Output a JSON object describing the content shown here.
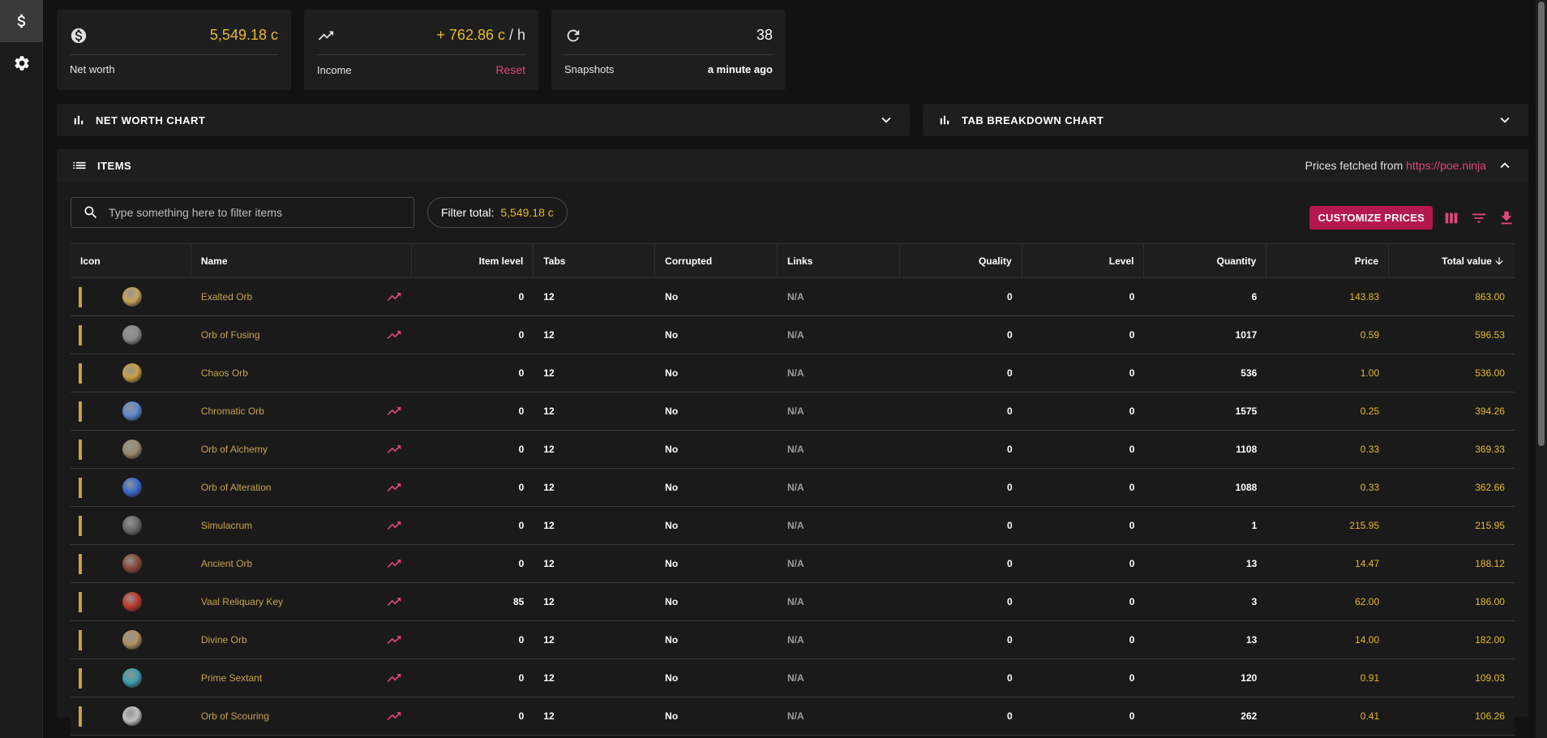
{
  "colors": {
    "accent": "#e0457c",
    "gold": "#e8b92a",
    "button": "#b5174f"
  },
  "sidebar": {
    "items": [
      {
        "icon": "dollar-icon",
        "active": true
      },
      {
        "icon": "gear-icon",
        "active": false
      }
    ]
  },
  "cards": {
    "networth": {
      "value": "5,549.18 c",
      "label": "Net worth"
    },
    "income": {
      "value": "+ 762.86 c",
      "unit": " / h",
      "label": "Income",
      "reset": "Reset"
    },
    "snapshots": {
      "value": "38",
      "label": "Snapshots",
      "ago": "a minute ago"
    }
  },
  "charts": {
    "networth_title": "NET WORTH CHART",
    "tab_title": "TAB BREAKDOWN CHART"
  },
  "items": {
    "title": "ITEMS",
    "prices_from": "Prices fetched from",
    "prices_link": "https://poe.ninja",
    "search_placeholder": "Type something here to filter items",
    "filter_total_label": "Filter total:",
    "filter_total_value": "5,549.18 c",
    "customize": "CUSTOMIZE PRICES",
    "columns": {
      "icon": "Icon",
      "name": "Name",
      "ilvl": "Item level",
      "tabs": "Tabs",
      "corrupted": "Corrupted",
      "links": "Links",
      "quality": "Quality",
      "level": "Level",
      "quantity": "Quantity",
      "price": "Price",
      "total": "Total value"
    },
    "rows": [
      {
        "name": "Exalted Orb",
        "ilvl": "0",
        "tabs": "12",
        "corrupted": "No",
        "links": "N/A",
        "quality": "0",
        "level": "0",
        "quantity": "6",
        "price": "143.83",
        "total": "863.00",
        "trend": true,
        "color": "#c8a35a"
      },
      {
        "name": "Orb of Fusing",
        "ilvl": "0",
        "tabs": "12",
        "corrupted": "No",
        "links": "N/A",
        "quality": "0",
        "level": "0",
        "quantity": "1017",
        "price": "0.59",
        "total": "596.53",
        "trend": true,
        "color": "#8a8a8a"
      },
      {
        "name": "Chaos Orb",
        "ilvl": "0",
        "tabs": "12",
        "corrupted": "No",
        "links": "N/A",
        "quality": "0",
        "level": "0",
        "quantity": "536",
        "price": "1.00",
        "total": "536.00",
        "trend": false,
        "color": "#c9a040"
      },
      {
        "name": "Chromatic Orb",
        "ilvl": "0",
        "tabs": "12",
        "corrupted": "No",
        "links": "N/A",
        "quality": "0",
        "level": "0",
        "quantity": "1575",
        "price": "0.25",
        "total": "394.26",
        "trend": true,
        "color": "#5a8ad0"
      },
      {
        "name": "Orb of Alchemy",
        "ilvl": "0",
        "tabs": "12",
        "corrupted": "No",
        "links": "N/A",
        "quality": "0",
        "level": "0",
        "quantity": "1108",
        "price": "0.33",
        "total": "369.33",
        "trend": true,
        "color": "#9a8a6a"
      },
      {
        "name": "Orb of Alteration",
        "ilvl": "0",
        "tabs": "12",
        "corrupted": "No",
        "links": "N/A",
        "quality": "0",
        "level": "0",
        "quantity": "1088",
        "price": "0.33",
        "total": "362.66",
        "trend": true,
        "color": "#3a6ad0"
      },
      {
        "name": "Simulacrum",
        "ilvl": "0",
        "tabs": "12",
        "corrupted": "No",
        "links": "N/A",
        "quality": "0",
        "level": "0",
        "quantity": "1",
        "price": "215.95",
        "total": "215.95",
        "trend": true,
        "color": "#6a6a6a"
      },
      {
        "name": "Ancient Orb",
        "ilvl": "0",
        "tabs": "12",
        "corrupted": "No",
        "links": "N/A",
        "quality": "0",
        "level": "0",
        "quantity": "13",
        "price": "14.47",
        "total": "188.12",
        "trend": true,
        "color": "#8a4a3a"
      },
      {
        "name": "Vaal Reliquary Key",
        "ilvl": "85",
        "tabs": "12",
        "corrupted": "No",
        "links": "N/A",
        "quality": "0",
        "level": "0",
        "quantity": "3",
        "price": "62.00",
        "total": "186.00",
        "trend": true,
        "color": "#c03a2a"
      },
      {
        "name": "Divine Orb",
        "ilvl": "0",
        "tabs": "12",
        "corrupted": "No",
        "links": "N/A",
        "quality": "0",
        "level": "0",
        "quantity": "13",
        "price": "14.00",
        "total": "182.00",
        "trend": true,
        "color": "#b09060"
      },
      {
        "name": "Prime Sextant",
        "ilvl": "0",
        "tabs": "12",
        "corrupted": "No",
        "links": "N/A",
        "quality": "0",
        "level": "0",
        "quantity": "120",
        "price": "0.91",
        "total": "109.03",
        "trend": true,
        "color": "#3aa0b0"
      },
      {
        "name": "Orb of Scouring",
        "ilvl": "0",
        "tabs": "12",
        "corrupted": "No",
        "links": "N/A",
        "quality": "0",
        "level": "0",
        "quantity": "262",
        "price": "0.41",
        "total": "106.26",
        "trend": true,
        "color": "#c0c0c0"
      }
    ]
  }
}
